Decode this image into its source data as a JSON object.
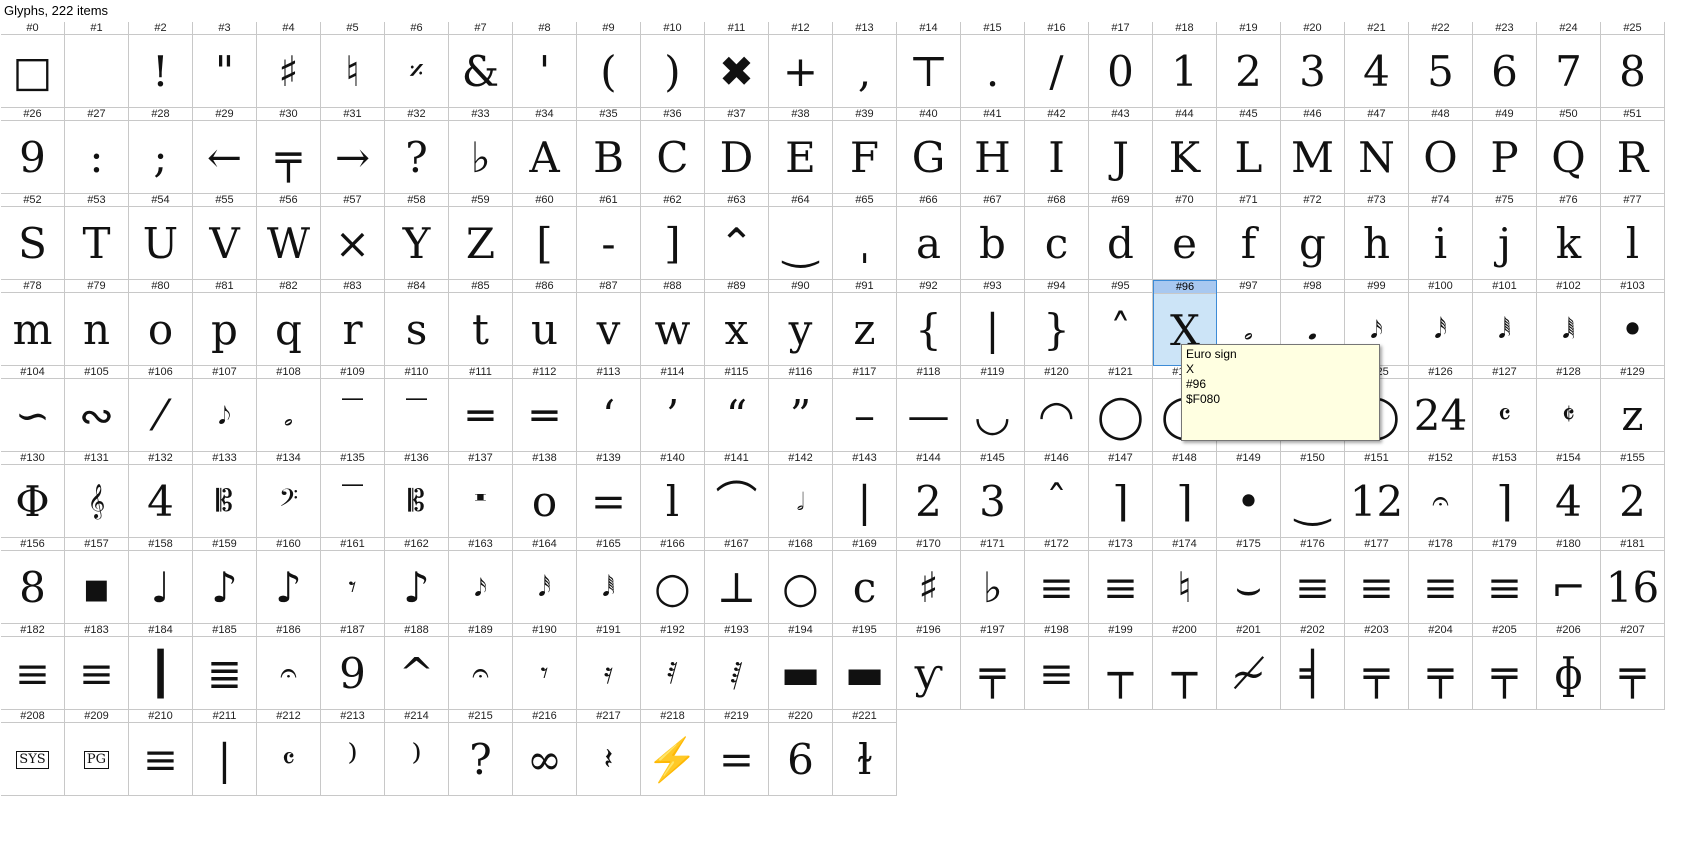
{
  "window": {
    "title": "Glyphs, 222 items"
  },
  "grid": {
    "columns": 26,
    "selected_index": 96,
    "glyphs": [
      "□",
      "",
      "!",
      "\"",
      "♯",
      "♮",
      "𝄎",
      "&",
      "'",
      "(",
      ")",
      "✖",
      "+",
      ",",
      "⊤",
      ".",
      "/",
      "0",
      "1",
      "2",
      "3",
      "4",
      "5",
      "6",
      "7",
      "8",
      "9",
      ":",
      ";",
      "←",
      "╤",
      "→",
      "?",
      "♭",
      "A",
      "B",
      "C",
      "D",
      "E",
      "F",
      "G",
      "H",
      "I",
      "J",
      "K",
      "L",
      "M",
      "N",
      "O",
      "P",
      "Q",
      "R",
      "S",
      "T",
      "U",
      "V",
      "W",
      "×",
      "Y",
      "Z",
      "[",
      "-",
      "]",
      "⌃",
      "‿",
      "ˌ",
      "a",
      "b",
      "c",
      "d",
      "e",
      "f",
      "g",
      "h",
      "i",
      "j",
      "k",
      "l",
      "m",
      "n",
      "o",
      "p",
      "q",
      "r",
      "s",
      "t",
      "u",
      "v",
      "w",
      "x",
      "y",
      "z",
      "{",
      "|",
      "}",
      "˄",
      "X",
      "𝅗",
      "𝅘",
      "𝅘𝅥𝅯",
      "𝅘𝅥𝅰",
      "𝅘𝅥𝅱",
      "𝅘𝅥𝅲",
      "•",
      "∽",
      "∾",
      "⁄",
      "𝅘𝅥𝅮",
      "𝅗",
      "‾",
      "‾",
      "═",
      "═",
      "‘",
      "’",
      "“",
      "”",
      "–",
      "—",
      "◡",
      "◠",
      "◯",
      "◯",
      "◯",
      "◯",
      "◯",
      "24",
      "𝄴",
      "𝄵",
      "ᴢ",
      "Φ",
      "𝄞",
      "4",
      "𝄡",
      "𝄢",
      "‾",
      "𝄡",
      "𝄺",
      "o",
      "=",
      "l",
      "⌒",
      "𝅗𝅥",
      "|",
      "2",
      "3",
      "ˆ",
      "⌉",
      "⌉",
      "•",
      "‿",
      "12",
      "𝄐",
      "⌉",
      "4",
      "2",
      "8",
      "▪",
      "♩",
      "♪",
      "♪",
      "𝄾",
      "♪",
      "𝅘𝅥𝅯",
      "𝅘𝅥𝅰",
      "𝅘𝅥𝅱",
      "○",
      "⊥",
      "○",
      "c",
      "♯",
      "♭",
      "≡",
      "≡",
      "♮",
      "⌣",
      "≡",
      "≡",
      "≡",
      "≡",
      "⌐",
      "16",
      "≡",
      "≡",
      "┃",
      "≣",
      "𝄐",
      "9",
      "^",
      "𝄐",
      "𝄾",
      "𝄿",
      "𝅀",
      "𝅁",
      "▬",
      "▬",
      "ƴ",
      "╤",
      "≡",
      "┬",
      "┬",
      "≁",
      "╡",
      "╤",
      "╤",
      "╤",
      "ɸ",
      "╤",
      "SYS",
      "PG",
      "≡",
      "|",
      "𝄴",
      "⁾",
      "⁾",
      "?",
      "∞",
      "𝄽",
      "⚡",
      "=",
      "6",
      "ɫ"
    ]
  },
  "tooltip": {
    "name": "Euro sign",
    "char": "X",
    "index": "#96",
    "code": "$F080"
  },
  "colors": {
    "selected_bg": "#cce4f7",
    "selected_border": "#3d8bd6",
    "tooltip_bg": "#ffffe1"
  }
}
